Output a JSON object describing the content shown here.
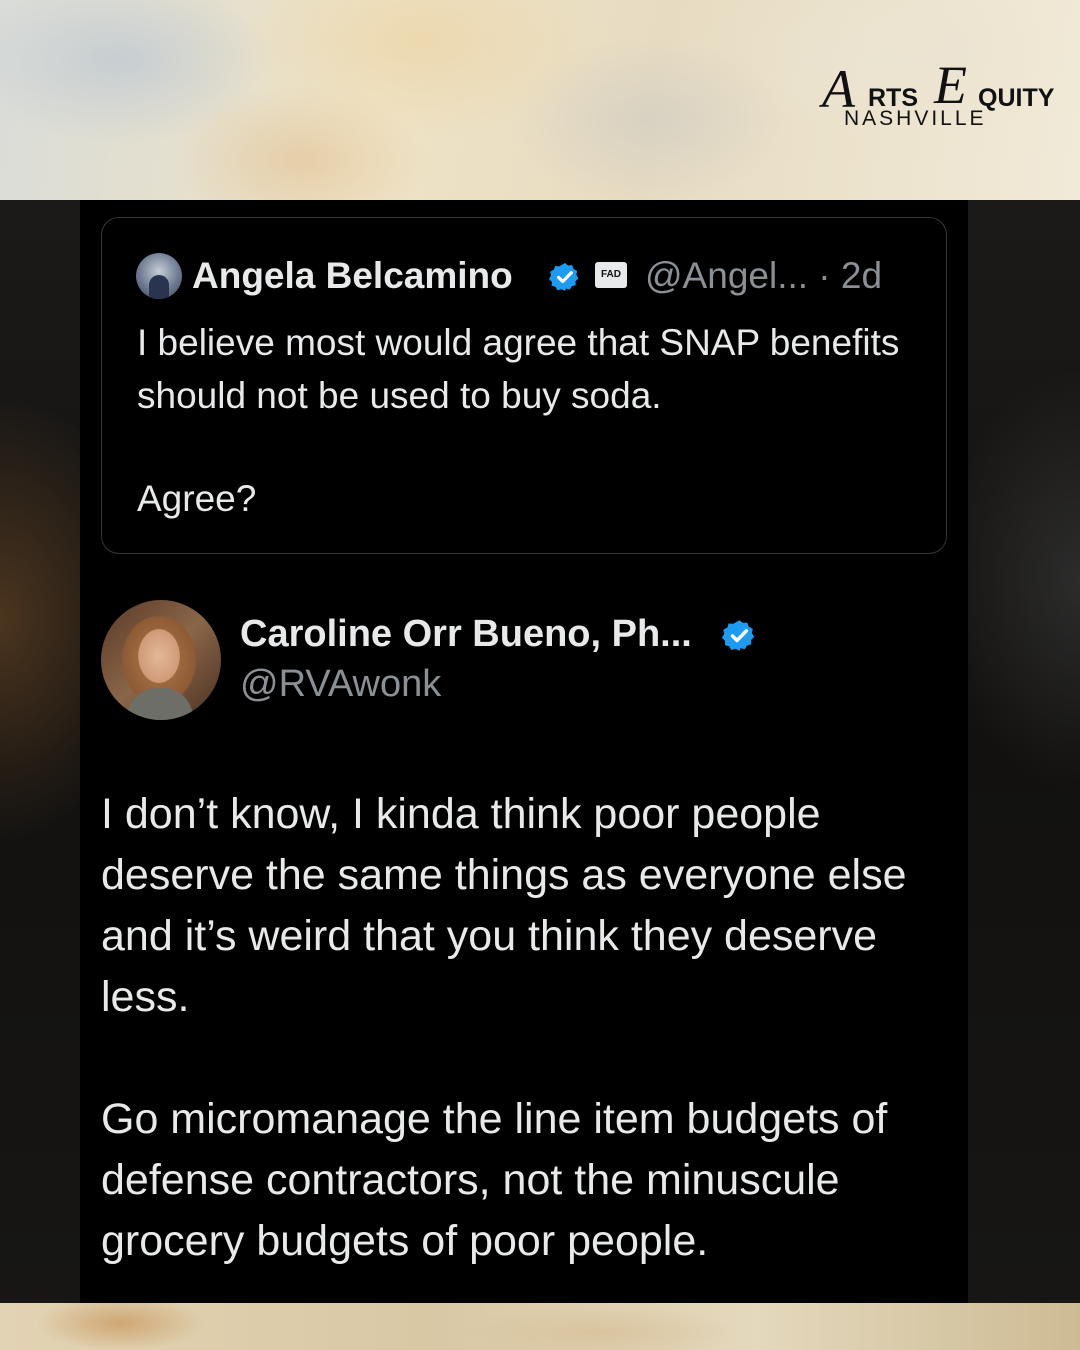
{
  "logo": {
    "script_a": "A",
    "word_a": "RTS",
    "script_e": "E",
    "word_e": "QUITY",
    "bottom": "NASHVILLE"
  },
  "quoted_tweet": {
    "author": "Angela Belcamino",
    "flag_badge": "FAD",
    "handle_time": "@Angel... · 2d",
    "text": "I believe most would agree that SNAP benefits should not be used to buy soda.",
    "text2": "Agree?"
  },
  "tweet": {
    "author": "Caroline Orr Bueno, Ph...",
    "handle": "@RVAwonk",
    "text": "I don’t know, I kinda think poor people deserve the same things as everyone else and it’s weird that you think they deserve less.",
    "text2": "Go micromanage the line item budgets of defense contractors, not the minuscule grocery budgets of poor people."
  },
  "colors": {
    "verified": "#1d9bf0",
    "text": "#e7e9ea",
    "muted": "#8b9095",
    "card_border": "#343638"
  }
}
